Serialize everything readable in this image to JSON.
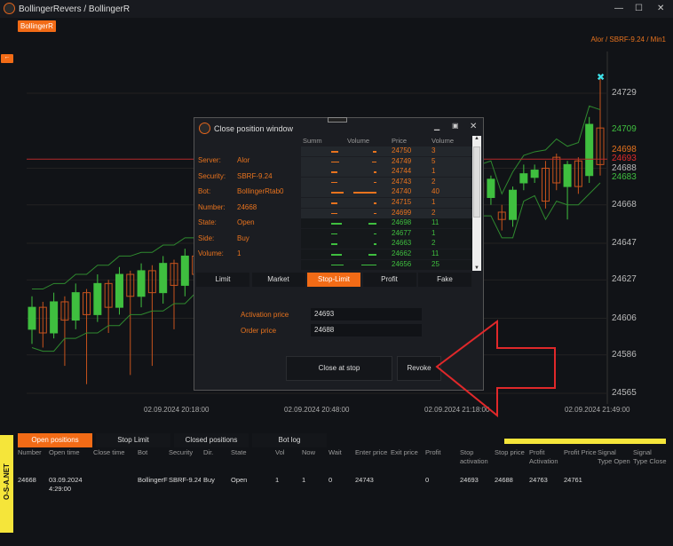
{
  "window": {
    "title": "BollingerRevers / BollingerR",
    "minimize": "—",
    "maximize": "☐",
    "close": "✕"
  },
  "bot_tab": "BollingerR",
  "collapse_label": "←",
  "chart": {
    "security_label": "Alor / SBRF-9.24 / Min1",
    "price_ticks": [
      24729,
      24709,
      24698,
      24693,
      24688,
      24683,
      24668,
      24647,
      24627,
      24606,
      24586,
      24565
    ],
    "price_tick_colors": [
      "#bbbbbb",
      "#3fbf3f",
      "#e8731e",
      "#e02a2a",
      "#bbbbbb",
      "#3fbf3f",
      "#bbbbbb",
      "#bbbbbb",
      "#bbbbbb",
      "#bbbbbb",
      "#bbbbbb",
      "#bbbbbb"
    ],
    "time_ticks": [
      "02.09.2024 20:18:00",
      "02.09.2024 20:48:00",
      "02.09.2024 21:18:00",
      "02.09.2024 21:49:00"
    ],
    "ylim": [
      24555,
      24745
    ],
    "marker_price": 24738,
    "level_line": 24693,
    "colors": {
      "up": "#3fbf3f",
      "down": "#c8531d",
      "band": "#2f8a2f",
      "level": "#b52a2a"
    },
    "candles": [
      [
        24600,
        24612,
        24592,
        24618
      ],
      [
        24612,
        24598,
        24590,
        24615
      ],
      [
        24598,
        24615,
        24595,
        24620
      ],
      [
        24615,
        24605,
        24580,
        24618
      ],
      [
        24605,
        24620,
        24600,
        24625
      ],
      [
        24620,
        24608,
        24570,
        24622
      ],
      [
        24608,
        24625,
        24604,
        24630
      ],
      [
        24625,
        24612,
        24598,
        24627
      ],
      [
        24612,
        24630,
        24608,
        24634
      ],
      [
        24630,
        24618,
        24575,
        24632
      ],
      [
        24618,
        24632,
        24612,
        24636
      ],
      [
        24632,
        24620,
        24580,
        24635
      ],
      [
        24620,
        24636,
        24614,
        24640
      ],
      [
        24636,
        24624,
        24600,
        24638
      ],
      [
        24624,
        24640,
        24618,
        24644
      ],
      [
        24640,
        24630,
        24620,
        24645
      ],
      [
        24630,
        24642,
        24625,
        24648
      ],
      [
        24642,
        24635,
        24628,
        24650
      ],
      [
        24635,
        24645,
        24630,
        24650
      ],
      [
        24645,
        24640,
        24630,
        24652
      ],
      [
        24640,
        24650,
        24636,
        24655
      ],
      [
        24650,
        24644,
        24638,
        24656
      ],
      [
        24644,
        24652,
        24640,
        24658
      ],
      [
        24652,
        24646,
        24640,
        24660
      ],
      [
        24646,
        24655,
        24642,
        24660
      ],
      [
        24655,
        24650,
        24644,
        24662
      ],
      [
        24650,
        24658,
        24646,
        24664
      ],
      [
        24658,
        24652,
        24646,
        24664
      ],
      [
        24652,
        24660,
        24648,
        24666
      ],
      [
        24660,
        24656,
        24650,
        24668
      ],
      [
        24656,
        24664,
        24652,
        24670
      ],
      [
        24664,
        24660,
        24654,
        24672
      ],
      [
        24660,
        24668,
        24656,
        24674
      ],
      [
        24668,
        24664,
        24658,
        24676
      ],
      [
        24664,
        24672,
        24660,
        24678
      ],
      [
        24672,
        24668,
        24662,
        24680
      ],
      [
        24668,
        24675,
        24664,
        24682
      ],
      [
        24675,
        24670,
        24664,
        24684
      ],
      [
        24670,
        24678,
        24666,
        24684
      ],
      [
        24678,
        24672,
        24666,
        24686
      ],
      [
        24672,
        24666,
        24660,
        24688
      ],
      [
        24680,
        24672,
        24664,
        24684
      ],
      [
        24672,
        24682,
        24668,
        24684
      ],
      [
        24664,
        24660,
        24654,
        24668
      ],
      [
        24660,
        24676,
        24656,
        24678
      ],
      [
        24680,
        24685,
        24676,
        24690
      ],
      [
        24683,
        24687,
        24680,
        24690
      ],
      [
        24688,
        24670,
        24666,
        24692
      ],
      [
        24694,
        24680,
        24676,
        24696
      ],
      [
        24678,
        24690,
        24660,
        24692
      ],
      [
        24692,
        24678,
        24674,
        24694
      ],
      [
        24684,
        24712,
        24680,
        24716
      ],
      [
        24710,
        24690,
        24684,
        24738
      ]
    ]
  },
  "dialog": {
    "title": "Close position window",
    "info": [
      {
        "label": "Server:",
        "value": "Alor"
      },
      {
        "label": "Security:",
        "value": "SBRF-9.24"
      },
      {
        "label": "Bot:",
        "value": "BollingerRtab0"
      },
      {
        "label": "Number:",
        "value": "24668"
      },
      {
        "label": "State:",
        "value": "Open"
      },
      {
        "label": "Side:",
        "value": "Buy"
      },
      {
        "label": "Volume:",
        "value": "1"
      }
    ],
    "orderbook_headers": [
      "Summ",
      "Volume",
      "Price",
      "Volume"
    ],
    "asks": [
      {
        "price": "24750",
        "volume": "3"
      },
      {
        "price": "24749",
        "volume": "5"
      },
      {
        "price": "24744",
        "volume": "1"
      },
      {
        "price": "24743",
        "volume": "2"
      },
      {
        "price": "24740",
        "volume": "40"
      },
      {
        "price": "24715",
        "volume": "1"
      },
      {
        "price": "24699",
        "volume": "2"
      }
    ],
    "bids": [
      {
        "price": "24698",
        "volume": "11"
      },
      {
        "price": "24677",
        "volume": "1"
      },
      {
        "price": "24663",
        "volume": "2"
      },
      {
        "price": "24662",
        "volume": "11"
      },
      {
        "price": "24656",
        "volume": "25"
      }
    ],
    "tabs": [
      "Limit",
      "Market",
      "Stop-Limit",
      "Profit",
      "Fake"
    ],
    "active_tab": "Stop-Limit",
    "activation_label": "Activation price",
    "activation_value": "24693",
    "order_label": "Order price",
    "order_value": "24688",
    "close_at_stop": "Close at stop",
    "revoke": "Revoke"
  },
  "bottom": {
    "brand": "O-S-A.NET",
    "tabs": [
      "Open positions",
      "Stop Limit",
      "Closed positions",
      "Bot log"
    ],
    "active_tab": "Open positions",
    "headers": [
      "Number",
      "Open time",
      "Close time",
      "Bot",
      "Security",
      "Dir.",
      "State",
      "Vol",
      "Now",
      "Wait",
      "Enter price",
      "Exit price",
      "Profit",
      "Stop activation",
      "Stop price",
      "Profit Activation",
      "Profit Price",
      "Signal Type Open",
      "Signal Type Close"
    ],
    "rows": [
      [
        "24668",
        "03.09.2024 4:29:00",
        "",
        "BollingerF",
        "SBRF-9.24",
        "Buy",
        "Open",
        "1",
        "1",
        "0",
        "24743",
        "",
        "0",
        "24693",
        "24688",
        "24763",
        "24761",
        "",
        ""
      ]
    ]
  },
  "annotation_color": "#e0282a"
}
